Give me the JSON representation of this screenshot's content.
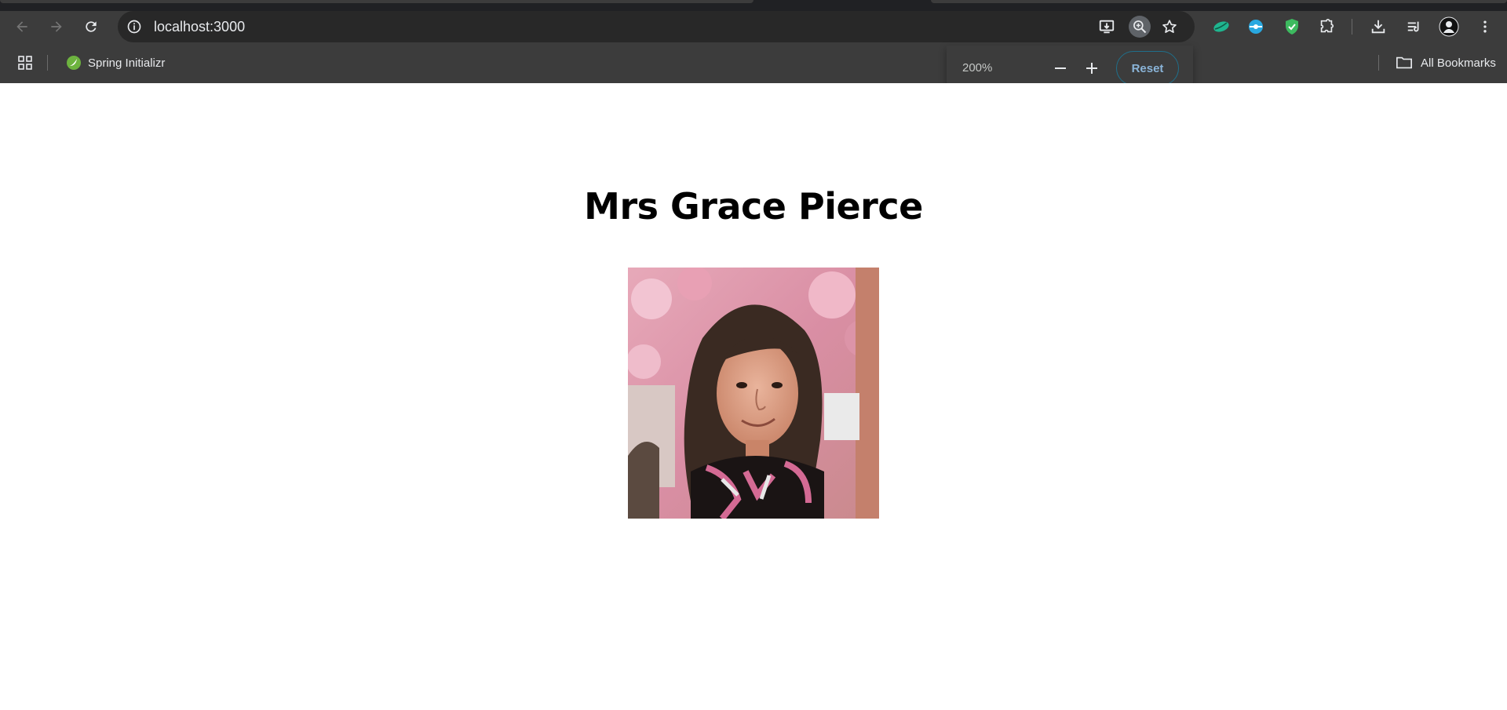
{
  "browser": {
    "url": "localhost:3000",
    "bookmarks": [
      {
        "label": "Spring Initializr",
        "icon": "spring-leaf-icon"
      }
    ],
    "all_bookmarks_label": "All Bookmarks",
    "zoom": {
      "level": "200%",
      "reset_label": "Reset"
    }
  },
  "profile": {
    "name": "Mrs Grace Pierce",
    "photo": "profile-photo"
  },
  "colors": {
    "chrome_dark": "#3c3c3c",
    "omnibox": "#282828",
    "text_light": "#e8eaed",
    "reset_border": "#1f6f8b",
    "page_bg": "#ffffff"
  }
}
